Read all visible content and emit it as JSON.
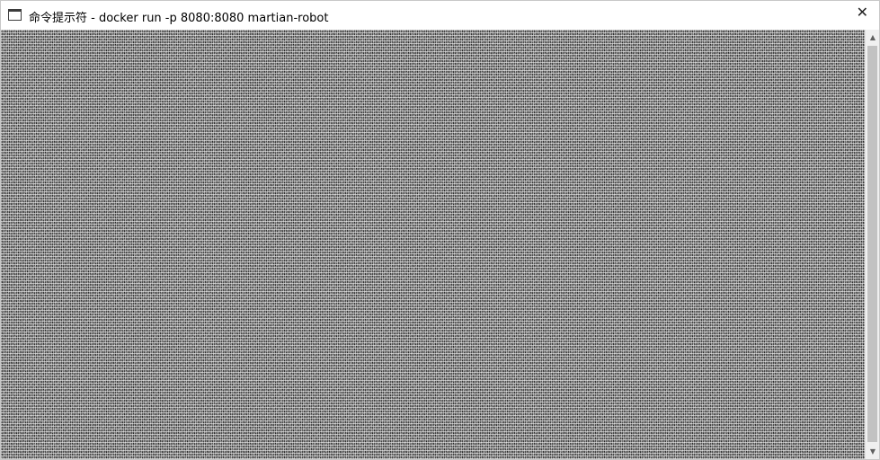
{
  "window": {
    "title": "命令提示符 - docker  run -p 8080:8080 martian-robot"
  },
  "titlebar": {
    "app_icon": "console-window-icon",
    "close_glyph": "✕"
  },
  "scrollbar": {
    "up_glyph": "▲",
    "down_glyph": "▼"
  },
  "colors": {
    "titlebar_bg": "#ffffff",
    "console_bg": "#4a4a4a",
    "scrollbar_bg": "#f0f0f0",
    "scroll_thumb": "#c2c2c2"
  }
}
